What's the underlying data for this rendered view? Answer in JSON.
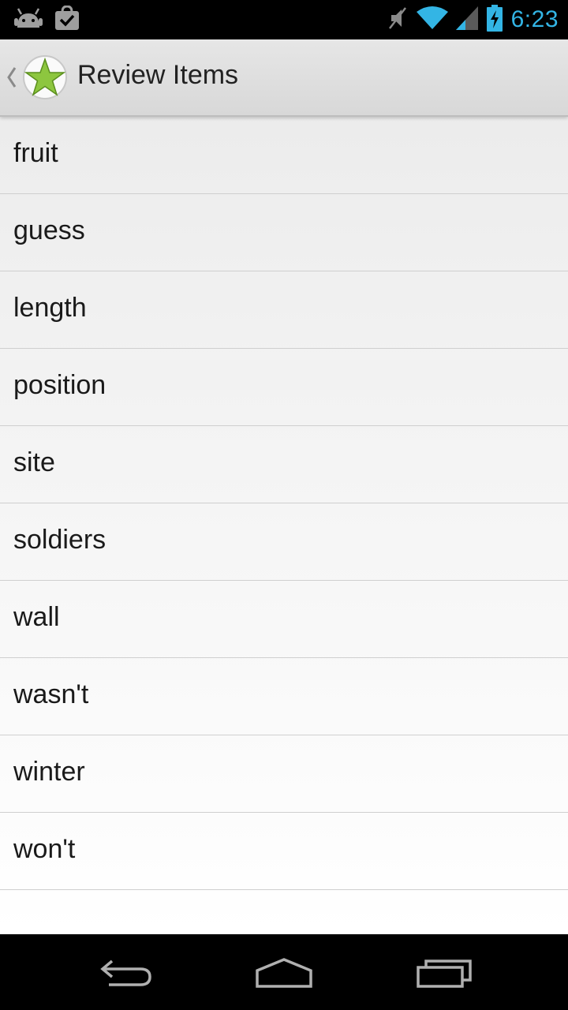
{
  "status_bar": {
    "time": "6:23",
    "left_icons": [
      "android-icon",
      "shopping-bag-icon"
    ],
    "right_icons": [
      "mute-icon",
      "wifi-icon",
      "signal-icon",
      "battery-charging-icon"
    ],
    "accent_color": "#33b5e5"
  },
  "action_bar": {
    "title": "Review Items",
    "icon": "green-star-icon"
  },
  "list": {
    "items": [
      {
        "label": "fruit"
      },
      {
        "label": "guess"
      },
      {
        "label": "length"
      },
      {
        "label": "position"
      },
      {
        "label": "site"
      },
      {
        "label": "soldiers"
      },
      {
        "label": "wall"
      },
      {
        "label": "wasn't"
      },
      {
        "label": "winter"
      },
      {
        "label": "won't"
      }
    ]
  },
  "nav_bar": {
    "buttons": [
      "back-icon",
      "home-icon",
      "recent-apps-icon"
    ]
  }
}
